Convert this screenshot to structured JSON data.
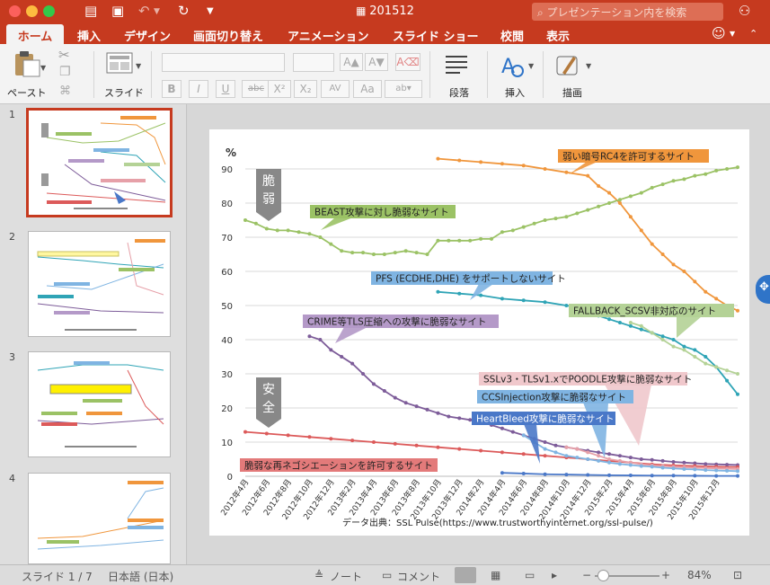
{
  "window": {
    "title": "201512",
    "search_placeholder": "プレゼンテーション内を検索"
  },
  "tabs": [
    "ホーム",
    "挿入",
    "デザイン",
    "画面切り替え",
    "アニメーション",
    "スライド ショー",
    "校閲",
    "表示"
  ],
  "ribbon": {
    "paste_label": "ペースト",
    "slide_label": "スライド",
    "paragraph_label": "段落",
    "insert_label": "挿入",
    "draw_label": "描画",
    "format_buttons": [
      "B",
      "I",
      "U",
      "abc",
      "X²",
      "X₂",
      "AV",
      "Aa"
    ]
  },
  "thumbnails": [
    {
      "number": "1"
    },
    {
      "number": "2"
    },
    {
      "number": "3"
    },
    {
      "number": "4"
    }
  ],
  "status": {
    "slide_info": "スライド 1 / 7",
    "language": "日本語 (日本)",
    "notes_label": "ノート",
    "comments_label": "コメント",
    "zoom": "84%"
  },
  "colors": {
    "accent": "#c63a1f",
    "orange": "#f0963c",
    "green": "#9bc265",
    "cyan": "#2fa4b6",
    "purple": "#7d5c99",
    "red": "#dc5a5a",
    "blue": "#4a78c8",
    "light_green": "#b4d296",
    "light_blue": "#7fb4e2",
    "pink": "#e6a0a8",
    "gray": "#999999"
  },
  "chart_data": {
    "type": "line",
    "ylabel": "%",
    "ylim": [
      0,
      90
    ],
    "yticks": [
      0,
      10,
      20,
      30,
      40,
      50,
      60,
      70,
      80,
      90
    ],
    "x_tick_labels": [
      "2012年4月",
      "2012年6月",
      "2012年8月",
      "2012年10月",
      "2012年12月",
      "2013年2月",
      "2013年4月",
      "2013年6月",
      "2013年8月",
      "2013年10月",
      "2013年12月",
      "2014年2月",
      "2014年4月",
      "2014年6月",
      "2014年8月",
      "2014年10月",
      "2014年12月",
      "2015年2月",
      "2015年4月",
      "2015年6月",
      "2015年8月",
      "2015年10月",
      "2015年12月"
    ],
    "source": "データ出典：SSL Pulse(https://www.trustworthyinternet.org/ssl-pulse/)",
    "side_labels": {
      "weak": "脆\n弱",
      "safe": "安\n全"
    },
    "series": [
      {
        "name": "弱い暗号RC4を許可するサイト",
        "color": "#f0963c",
        "points": [
          [
            18,
            93
          ],
          [
            20,
            92.5
          ],
          [
            22,
            92
          ],
          [
            24,
            91.5
          ],
          [
            26,
            91
          ],
          [
            28,
            90
          ],
          [
            30,
            89
          ],
          [
            32,
            88
          ],
          [
            33,
            85
          ],
          [
            34,
            83
          ],
          [
            35,
            80
          ],
          [
            36,
            76
          ],
          [
            37,
            72
          ],
          [
            38,
            68
          ],
          [
            39,
            65
          ],
          [
            40,
            62
          ],
          [
            41,
            60
          ],
          [
            42,
            57
          ],
          [
            43,
            54
          ],
          [
            44,
            52
          ],
          [
            45,
            50
          ],
          [
            46,
            48.5
          ]
        ]
      },
      {
        "name": "BEAST攻撃に対し脆弱なサイト",
        "color": "#9bc265",
        "points": [
          [
            0,
            75
          ],
          [
            1,
            74
          ],
          [
            2,
            72.5
          ],
          [
            3,
            72
          ],
          [
            4,
            72
          ],
          [
            5,
            71.5
          ],
          [
            6,
            71
          ],
          [
            7,
            70
          ],
          [
            8,
            68
          ],
          [
            9,
            66
          ],
          [
            10,
            65.5
          ],
          [
            11,
            65.5
          ],
          [
            12,
            65
          ],
          [
            13,
            65
          ],
          [
            14,
            65.5
          ],
          [
            15,
            66
          ],
          [
            16,
            65.5
          ],
          [
            17,
            65
          ],
          [
            18,
            69
          ],
          [
            19,
            69
          ],
          [
            20,
            69
          ],
          [
            21,
            69
          ],
          [
            22,
            69.5
          ],
          [
            23,
            69.5
          ],
          [
            24,
            71.5
          ],
          [
            25,
            72
          ],
          [
            26,
            73
          ],
          [
            27,
            74
          ],
          [
            28,
            75
          ],
          [
            29,
            75.5
          ],
          [
            30,
            76
          ],
          [
            31,
            77
          ],
          [
            32,
            78
          ],
          [
            33,
            79
          ],
          [
            34,
            80
          ],
          [
            35,
            81
          ],
          [
            36,
            82
          ],
          [
            37,
            83
          ],
          [
            38,
            84.5
          ],
          [
            39,
            85.5
          ],
          [
            40,
            86.5
          ],
          [
            41,
            87
          ],
          [
            42,
            88
          ],
          [
            43,
            88.5
          ],
          [
            44,
            89.5
          ],
          [
            45,
            90
          ],
          [
            46,
            90.5
          ]
        ]
      },
      {
        "name": "PFS (ECDHE,DHE) をサポートしないサイト",
        "color": "#2fa4b6",
        "points": [
          [
            18,
            54
          ],
          [
            20,
            53.5
          ],
          [
            22,
            53
          ],
          [
            24,
            52
          ],
          [
            26,
            51.5
          ],
          [
            28,
            51
          ],
          [
            30,
            50
          ],
          [
            32,
            49
          ],
          [
            33,
            47
          ],
          [
            34,
            46
          ],
          [
            35,
            45
          ],
          [
            36,
            44
          ],
          [
            37,
            43
          ],
          [
            38,
            42
          ],
          [
            39,
            41
          ],
          [
            40,
            40
          ],
          [
            41,
            38
          ],
          [
            42,
            37
          ],
          [
            43,
            35
          ],
          [
            44,
            32
          ],
          [
            45,
            28
          ],
          [
            46,
            24
          ]
        ]
      },
      {
        "name": "FALLBACK_SCSV非対応のサイト",
        "color": "#b4d296",
        "points": [
          [
            36,
            45
          ],
          [
            37,
            44
          ],
          [
            38,
            42
          ],
          [
            39,
            40
          ],
          [
            40,
            38
          ],
          [
            41,
            37
          ],
          [
            42,
            35
          ],
          [
            43,
            33
          ],
          [
            44,
            32
          ],
          [
            45,
            31
          ],
          [
            46,
            30
          ]
        ]
      },
      {
        "name": "CRIME等TLS圧縮への攻撃に脆弱なサイト",
        "color": "#7d5c99",
        "points": [
          [
            6,
            41
          ],
          [
            7,
            40
          ],
          [
            8,
            37
          ],
          [
            9,
            35
          ],
          [
            10,
            33
          ],
          [
            11,
            30
          ],
          [
            12,
            27
          ],
          [
            13,
            25
          ],
          [
            14,
            23
          ],
          [
            15,
            21.5
          ],
          [
            16,
            20.5
          ],
          [
            17,
            19.5
          ],
          [
            18,
            18.5
          ],
          [
            19,
            17.5
          ],
          [
            20,
            17
          ],
          [
            21,
            16.5
          ],
          [
            22,
            16
          ],
          [
            23,
            15
          ],
          [
            24,
            14
          ],
          [
            25,
            13
          ],
          [
            26,
            12
          ],
          [
            27,
            11
          ],
          [
            28,
            10
          ],
          [
            29,
            9
          ],
          [
            30,
            8.5
          ],
          [
            31,
            8
          ],
          [
            32,
            7.5
          ],
          [
            33,
            7
          ],
          [
            34,
            6.5
          ],
          [
            35,
            6
          ],
          [
            36,
            5.5
          ],
          [
            37,
            5
          ],
          [
            38,
            4.8
          ],
          [
            39,
            4.5
          ],
          [
            40,
            4.2
          ],
          [
            41,
            4
          ],
          [
            42,
            3.8
          ],
          [
            43,
            3.6
          ],
          [
            44,
            3.5
          ],
          [
            45,
            3.4
          ],
          [
            46,
            3.3
          ]
        ]
      },
      {
        "name": "脆弱な再ネゴシエーションを許可するサイト",
        "color": "#dc5a5a",
        "points": [
          [
            0,
            13
          ],
          [
            2,
            12.5
          ],
          [
            4,
            12
          ],
          [
            6,
            11.5
          ],
          [
            8,
            11
          ],
          [
            10,
            10.5
          ],
          [
            12,
            10
          ],
          [
            14,
            9.5
          ],
          [
            16,
            9
          ],
          [
            18,
            8.5
          ],
          [
            20,
            8
          ],
          [
            22,
            7.5
          ],
          [
            24,
            7
          ],
          [
            26,
            6.5
          ],
          [
            28,
            6
          ],
          [
            30,
            5.5
          ],
          [
            32,
            5
          ],
          [
            34,
            4.5
          ],
          [
            36,
            4
          ],
          [
            38,
            3.5
          ],
          [
            40,
            3.2
          ],
          [
            42,
            3
          ],
          [
            44,
            2.8
          ],
          [
            46,
            2.7
          ]
        ]
      },
      {
        "name": "SSLv3・TLSv1.xでPOODLE攻撃に脆弱なサイト",
        "color": "#e6a0a8",
        "points": [
          [
            30,
            8.5
          ],
          [
            31,
            8
          ],
          [
            32,
            7
          ],
          [
            33,
            6
          ],
          [
            34,
            5
          ],
          [
            35,
            4.5
          ],
          [
            36,
            4
          ],
          [
            37,
            3.5
          ],
          [
            38,
            3.2
          ],
          [
            39,
            3
          ],
          [
            40,
            2.8
          ],
          [
            41,
            2.6
          ],
          [
            42,
            2.5
          ],
          [
            43,
            2.4
          ],
          [
            44,
            2.3
          ],
          [
            45,
            2.2
          ],
          [
            46,
            2.1
          ]
        ]
      },
      {
        "name": "CCSInjection攻撃に脆弱なサイト",
        "color": "#7fb4e2",
        "points": [
          [
            26,
            12
          ],
          [
            27,
            10
          ],
          [
            28,
            8
          ],
          [
            29,
            7
          ],
          [
            30,
            6
          ],
          [
            31,
            5.5
          ],
          [
            32,
            5
          ],
          [
            33,
            4.5
          ],
          [
            34,
            4
          ],
          [
            35,
            3.6
          ],
          [
            36,
            3.3
          ],
          [
            37,
            3
          ],
          [
            38,
            2.8
          ],
          [
            39,
            2.5
          ],
          [
            40,
            2.3
          ],
          [
            41,
            2.1
          ],
          [
            42,
            2
          ],
          [
            43,
            1.8
          ],
          [
            44,
            1.7
          ],
          [
            45,
            1.6
          ],
          [
            46,
            1.5
          ]
        ]
      },
      {
        "name": "HeartBleed攻撃に脆弱なサイト",
        "color": "#4a78c8",
        "points": [
          [
            24,
            1
          ],
          [
            26,
            0.8
          ],
          [
            28,
            0.6
          ],
          [
            30,
            0.5
          ],
          [
            32,
            0.4
          ],
          [
            34,
            0.3
          ],
          [
            36,
            0.25
          ],
          [
            38,
            0.2
          ],
          [
            40,
            0.2
          ],
          [
            42,
            0.15
          ],
          [
            44,
            0.1
          ],
          [
            46,
            0.1
          ]
        ]
      }
    ]
  }
}
